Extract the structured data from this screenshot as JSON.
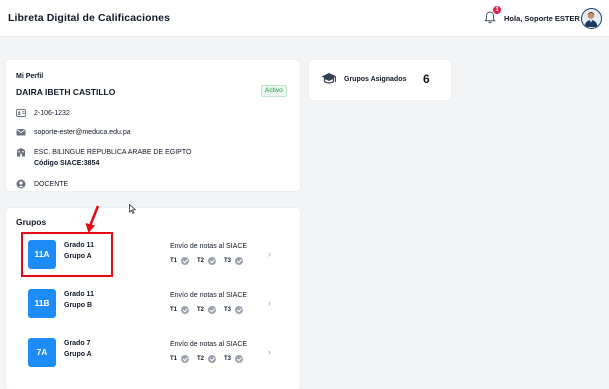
{
  "header": {
    "title": "Libreta Digital de Calificaciones",
    "notifications_count": "1",
    "greeting": "Hola, Soporte ESTER"
  },
  "profile": {
    "heading": "Mi Perfil",
    "name": "DAIRA IBETH CASTILLO",
    "status": "Activo",
    "id_number": "2-106-1232",
    "email": "soporte-ester@meduca.edu.pa",
    "school": "ESC. BILINGUE REPUBLICA ARABE DE EGIPTO",
    "school_code": "Código SIACE:3854",
    "role": "DOCENTE"
  },
  "assigned_groups": {
    "label": "Grupos Asignados",
    "count": "6"
  },
  "groups": {
    "heading": "Grupos",
    "siace_label": "Envío de notas al SIACE",
    "terms": [
      "T1",
      "T2",
      "T3"
    ],
    "items": [
      {
        "code": "11A",
        "grade": "Grado 11",
        "section": "Grupo A"
      },
      {
        "code": "11B",
        "grade": "Grado 11",
        "section": "Grupo B"
      },
      {
        "code": "7A",
        "grade": "Grado 7",
        "section": "Grupo A"
      }
    ]
  },
  "colors": {
    "accent": "#1d8cf8",
    "highlight": "#e50914",
    "badge_green": "#1e8e3e",
    "notification_red": "#e11d48"
  },
  "icons": {
    "id_card": "id-card-icon",
    "email": "envelope-icon",
    "school": "building-icon",
    "role": "user-icon",
    "assigned_groups": "graduation-cap-icon",
    "notifications": "bell-icon",
    "terms": "check-circle-icon",
    "row_action": "chevron-right-icon"
  }
}
